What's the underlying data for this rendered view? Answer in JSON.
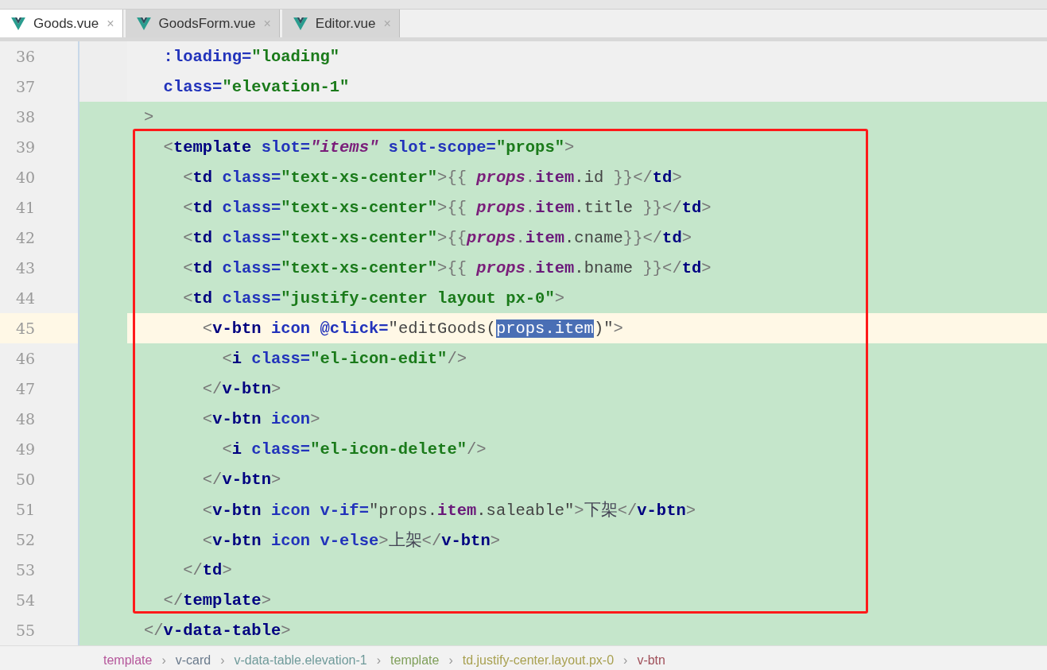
{
  "tabs": [
    {
      "label": "Goods.vue",
      "close": "×",
      "selected": true
    },
    {
      "label": "GoodsForm.vue",
      "close": "×",
      "selected": false
    },
    {
      "label": "Editor.vue",
      "close": "×",
      "selected": false
    }
  ],
  "lines": [
    {
      "number": "36",
      "current": false,
      "changed": false,
      "boxed": false,
      "tokens": [
        {
          "text": "  :loading=",
          "kind": "attr"
        },
        {
          "text": "\"loading\"",
          "kind": "val"
        }
      ]
    },
    {
      "number": "37",
      "current": false,
      "changed": false,
      "boxed": false,
      "tokens": [
        {
          "text": "  class=",
          "kind": "attr"
        },
        {
          "text": "\"elevation-1\"",
          "kind": "val"
        }
      ]
    },
    {
      "number": "38",
      "current": false,
      "changed": true,
      "boxed": false,
      "tokens": [
        {
          "text": ">",
          "kind": "p"
        }
      ]
    },
    {
      "number": "39",
      "current": false,
      "changed": true,
      "boxed": true,
      "tokens": [
        {
          "text": "  <",
          "kind": "p"
        },
        {
          "text": "template",
          "kind": "tag"
        },
        {
          "text": " slot=",
          "kind": "attr"
        },
        {
          "text": "\"items\"",
          "kind": "ital"
        },
        {
          "text": " slot-scope=",
          "kind": "attr"
        },
        {
          "text": "\"props\"",
          "kind": "val"
        },
        {
          "text": ">",
          "kind": "p"
        }
      ]
    },
    {
      "number": "40",
      "current": false,
      "changed": true,
      "boxed": true,
      "tokens": [
        {
          "text": "    <",
          "kind": "p"
        },
        {
          "text": "td",
          "kind": "tag"
        },
        {
          "text": " class=",
          "kind": "attr"
        },
        {
          "text": "\"text-xs-center\"",
          "kind": "val"
        },
        {
          "text": ">{{ ",
          "kind": "p"
        },
        {
          "text": "props",
          "kind": "ital"
        },
        {
          "text": ".",
          "kind": "p"
        },
        {
          "text": "item",
          "kind": "field"
        },
        {
          "text": ".id",
          "kind": "plain"
        },
        {
          "text": " }}</",
          "kind": "p"
        },
        {
          "text": "td",
          "kind": "tag"
        },
        {
          "text": ">",
          "kind": "p"
        }
      ]
    },
    {
      "number": "41",
      "current": false,
      "changed": true,
      "boxed": true,
      "tokens": [
        {
          "text": "    <",
          "kind": "p"
        },
        {
          "text": "td",
          "kind": "tag"
        },
        {
          "text": " class=",
          "kind": "attr"
        },
        {
          "text": "\"text-xs-center\"",
          "kind": "val"
        },
        {
          "text": ">{{ ",
          "kind": "p"
        },
        {
          "text": "props",
          "kind": "ital"
        },
        {
          "text": ".",
          "kind": "p"
        },
        {
          "text": "item",
          "kind": "field"
        },
        {
          "text": ".title",
          "kind": "plain"
        },
        {
          "text": " }}</",
          "kind": "p"
        },
        {
          "text": "td",
          "kind": "tag"
        },
        {
          "text": ">",
          "kind": "p"
        }
      ]
    },
    {
      "number": "42",
      "current": false,
      "changed": true,
      "boxed": true,
      "tokens": [
        {
          "text": "    <",
          "kind": "p"
        },
        {
          "text": "td",
          "kind": "tag"
        },
        {
          "text": " class=",
          "kind": "attr"
        },
        {
          "text": "\"text-xs-center\"",
          "kind": "val"
        },
        {
          "text": ">{{",
          "kind": "p"
        },
        {
          "text": "props",
          "kind": "ital"
        },
        {
          "text": ".",
          "kind": "p"
        },
        {
          "text": "item",
          "kind": "field"
        },
        {
          "text": ".cname",
          "kind": "plain"
        },
        {
          "text": "}}</",
          "kind": "p"
        },
        {
          "text": "td",
          "kind": "tag"
        },
        {
          "text": ">",
          "kind": "p"
        }
      ]
    },
    {
      "number": "43",
      "current": false,
      "changed": true,
      "boxed": true,
      "tokens": [
        {
          "text": "    <",
          "kind": "p"
        },
        {
          "text": "td",
          "kind": "tag"
        },
        {
          "text": " class=",
          "kind": "attr"
        },
        {
          "text": "\"text-xs-center\"",
          "kind": "val"
        },
        {
          "text": ">{{ ",
          "kind": "p"
        },
        {
          "text": "props",
          "kind": "ital"
        },
        {
          "text": ".",
          "kind": "p"
        },
        {
          "text": "item",
          "kind": "field"
        },
        {
          "text": ".bname",
          "kind": "plain"
        },
        {
          "text": " }}</",
          "kind": "p"
        },
        {
          "text": "td",
          "kind": "tag"
        },
        {
          "text": ">",
          "kind": "p"
        }
      ]
    },
    {
      "number": "44",
      "current": false,
      "changed": true,
      "boxed": true,
      "tokens": [
        {
          "text": "    <",
          "kind": "p"
        },
        {
          "text": "td",
          "kind": "tag"
        },
        {
          "text": " class=",
          "kind": "attr"
        },
        {
          "text": "\"justify-center layout px-0\"",
          "kind": "val"
        },
        {
          "text": ">",
          "kind": "p"
        }
      ]
    },
    {
      "number": "45",
      "current": true,
      "changed": true,
      "boxed": true,
      "tokens": [
        {
          "text": "      <",
          "kind": "p"
        },
        {
          "text": "v-btn",
          "kind": "tag"
        },
        {
          "text": " icon @click=",
          "kind": "attr"
        },
        {
          "text": "\"editGoods(",
          "kind": "plain"
        },
        {
          "text": "props.item",
          "kind": "sel"
        },
        {
          "text": ")\"",
          "kind": "plain"
        },
        {
          "text": ">",
          "kind": "p"
        }
      ]
    },
    {
      "number": "46",
      "current": false,
      "changed": true,
      "boxed": true,
      "tokens": [
        {
          "text": "        <",
          "kind": "p"
        },
        {
          "text": "i",
          "kind": "tag"
        },
        {
          "text": " class=",
          "kind": "attr"
        },
        {
          "text": "\"el-icon-edit\"",
          "kind": "val"
        },
        {
          "text": "/>",
          "kind": "p"
        }
      ]
    },
    {
      "number": "47",
      "current": false,
      "changed": true,
      "boxed": true,
      "tokens": [
        {
          "text": "      </",
          "kind": "p"
        },
        {
          "text": "v-btn",
          "kind": "tag"
        },
        {
          "text": ">",
          "kind": "p"
        }
      ]
    },
    {
      "number": "48",
      "current": false,
      "changed": true,
      "boxed": true,
      "tokens": [
        {
          "text": "      <",
          "kind": "p"
        },
        {
          "text": "v-btn",
          "kind": "tag"
        },
        {
          "text": " icon",
          "kind": "attr"
        },
        {
          "text": ">",
          "kind": "p"
        }
      ]
    },
    {
      "number": "49",
      "current": false,
      "changed": true,
      "boxed": true,
      "tokens": [
        {
          "text": "        <",
          "kind": "p"
        },
        {
          "text": "i",
          "kind": "tag"
        },
        {
          "text": " class=",
          "kind": "attr"
        },
        {
          "text": "\"el-icon-delete\"",
          "kind": "val"
        },
        {
          "text": "/>",
          "kind": "p"
        }
      ]
    },
    {
      "number": "50",
      "current": false,
      "changed": true,
      "boxed": true,
      "tokens": [
        {
          "text": "      </",
          "kind": "p"
        },
        {
          "text": "v-btn",
          "kind": "tag"
        },
        {
          "text": ">",
          "kind": "p"
        }
      ]
    },
    {
      "number": "51",
      "current": false,
      "changed": true,
      "boxed": true,
      "tokens": [
        {
          "text": "      <",
          "kind": "p"
        },
        {
          "text": "v-btn",
          "kind": "tag"
        },
        {
          "text": " icon v-if=",
          "kind": "attr"
        },
        {
          "text": "\"props.",
          "kind": "plain"
        },
        {
          "text": "item",
          "kind": "field"
        },
        {
          "text": ".saleable\"",
          "kind": "plain"
        },
        {
          "text": ">",
          "kind": "p"
        },
        {
          "text": "下架",
          "kind": "cn"
        },
        {
          "text": "</",
          "kind": "p"
        },
        {
          "text": "v-btn",
          "kind": "tag"
        },
        {
          "text": ">",
          "kind": "p"
        }
      ]
    },
    {
      "number": "52",
      "current": false,
      "changed": true,
      "boxed": true,
      "tokens": [
        {
          "text": "      <",
          "kind": "p"
        },
        {
          "text": "v-btn",
          "kind": "tag"
        },
        {
          "text": " icon v-else",
          "kind": "attr"
        },
        {
          "text": ">",
          "kind": "p"
        },
        {
          "text": "上架",
          "kind": "cn"
        },
        {
          "text": "</",
          "kind": "p"
        },
        {
          "text": "v-btn",
          "kind": "tag"
        },
        {
          "text": ">",
          "kind": "p"
        }
      ]
    },
    {
      "number": "53",
      "current": false,
      "changed": true,
      "boxed": true,
      "tokens": [
        {
          "text": "    </",
          "kind": "p"
        },
        {
          "text": "td",
          "kind": "tag"
        },
        {
          "text": ">",
          "kind": "p"
        }
      ]
    },
    {
      "number": "54",
      "current": false,
      "changed": true,
      "boxed": true,
      "tokens": [
        {
          "text": "  </",
          "kind": "p"
        },
        {
          "text": "template",
          "kind": "tag"
        },
        {
          "text": ">",
          "kind": "p"
        }
      ]
    },
    {
      "number": "55",
      "current": false,
      "changed": true,
      "boxed": false,
      "tokens": [
        {
          "text": "</",
          "kind": "p"
        },
        {
          "text": "v-data-table",
          "kind": "tag"
        },
        {
          "text": ">",
          "kind": "p"
        }
      ]
    }
  ],
  "breadcrumbs": [
    {
      "label": "template",
      "color": "#b5579b"
    },
    {
      "label": "v-card",
      "color": "#6a7a8c"
    },
    {
      "label": "v-data-table.elevation-1",
      "color": "#6f9a9a"
    },
    {
      "label": "template",
      "color": "#7f9f5a"
    },
    {
      "label": "td.justify-center.layout.px-0",
      "color": "#a8a050"
    },
    {
      "label": "v-btn",
      "color": "#a0505a"
    }
  ],
  "breadcrumb_separator": "›"
}
